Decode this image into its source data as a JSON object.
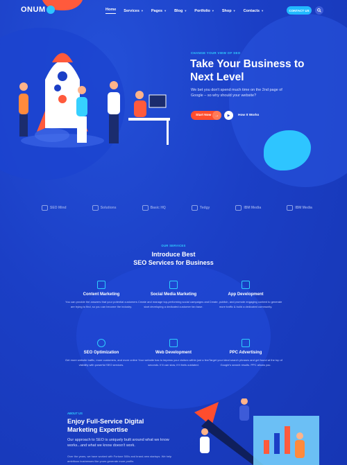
{
  "header": {
    "logo": "ONUM",
    "nav": [
      {
        "label": "Home",
        "active": true
      },
      {
        "label": "Services",
        "active": false
      },
      {
        "label": "Pages",
        "active": false
      },
      {
        "label": "Blog",
        "active": false
      },
      {
        "label": "Portfolio",
        "active": false
      },
      {
        "label": "Shop",
        "active": false
      },
      {
        "label": "Contacts",
        "active": false
      }
    ],
    "contact_button": "CONTACT US",
    "search_icon": "search-icon"
  },
  "hero": {
    "tagline": "CHANGE YOUR VIEW OF SEO",
    "title": "Take Your Business to Next Level",
    "text": "We bet you don't spend much time on the 2nd page of Google – so why should your website?",
    "start_button": "Start Now",
    "how_link": "How It Works"
  },
  "partners": [
    {
      "name": "SEO Mind"
    },
    {
      "name": "Solutions"
    },
    {
      "name": "Basic HQ"
    },
    {
      "name": "Tedgy"
    },
    {
      "name": "IBM Media"
    },
    {
      "name": "IBM Media"
    }
  ],
  "services": {
    "label": "OUR SERVICES",
    "title_line1": "Introduce Best",
    "title_line2": "SEO Services for Business",
    "items": [
      {
        "title": "Content Marketing",
        "desc": "You can provide the answers that your potential customers are trying to find, so you can become the industry."
      },
      {
        "title": "Social Media Marketing",
        "desc": "Create and manage top-performing social campaigns and start developing a dedicated customer fan base."
      },
      {
        "title": "App Development",
        "desc": "Create, publish, and promote engaging content to generate more traffic & build a dedicated community."
      },
      {
        "title": "SEO Optimization",
        "desc": "Get more website traffic, more customers, and more online visibility with powerful SEO services."
      },
      {
        "title": "Web Development",
        "desc": "Your website has to impress your visitors within just a few seconds. If it can slow, if it feels outdated."
      },
      {
        "title": "PPC Advertising",
        "desc": "Target your ideal search phrases and get found at the top of Google's search results. PPC allows you."
      }
    ]
  },
  "about": {
    "label": "ABOUT US",
    "title": "Enjoy Full-Service Digital Marketing Expertise",
    "text": "Our approach to SEO is uniquely built around what we know works...and what we know doesn't work.",
    "text2": "Over the years, we have worked with Fortune 500s and brand-new startups. We help ambitious businesses like yours generate more profits"
  },
  "colors": {
    "background": "#1a3fc4",
    "accent_cyan": "#2fd0ff",
    "accent_orange": "#ff4d2e",
    "contact_button": "#22b9ff"
  }
}
